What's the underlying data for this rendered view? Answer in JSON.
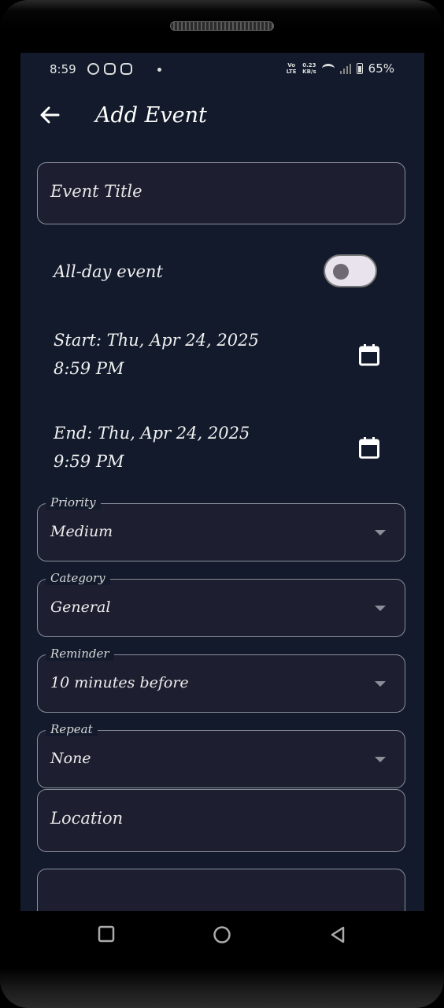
{
  "status_bar": {
    "time": "8:59",
    "network_label_top": "Vo LTE",
    "speed_top": "0.23",
    "speed_unit": "KB/s",
    "battery": "65%"
  },
  "app_bar": {
    "title": "Add Event",
    "back_icon": "arrow-left-icon"
  },
  "form": {
    "event_title_placeholder": "Event Title",
    "all_day_label": "All-day event",
    "all_day_enabled": false,
    "start_line1": "Start: Thu, Apr 24, 2025",
    "start_line2": "8:59 PM",
    "end_line1": "End: Thu, Apr 24, 2025",
    "end_line2": "9:59 PM",
    "priority": {
      "label": "Priority",
      "value": "Medium"
    },
    "category": {
      "label": "Category",
      "value": "General"
    },
    "reminder": {
      "label": "Reminder",
      "value": "10 minutes before"
    },
    "repeat": {
      "label": "Repeat",
      "value": "None"
    },
    "location_placeholder": "Location"
  },
  "nav": {
    "recents_icon": "square-icon",
    "home_icon": "circle-icon",
    "back_icon": "triangle-back-icon"
  },
  "colors": {
    "background": "#121a2b",
    "field_fill": "#1d1f30",
    "field_border": "#8a8f9a",
    "text": "#ffffff"
  }
}
